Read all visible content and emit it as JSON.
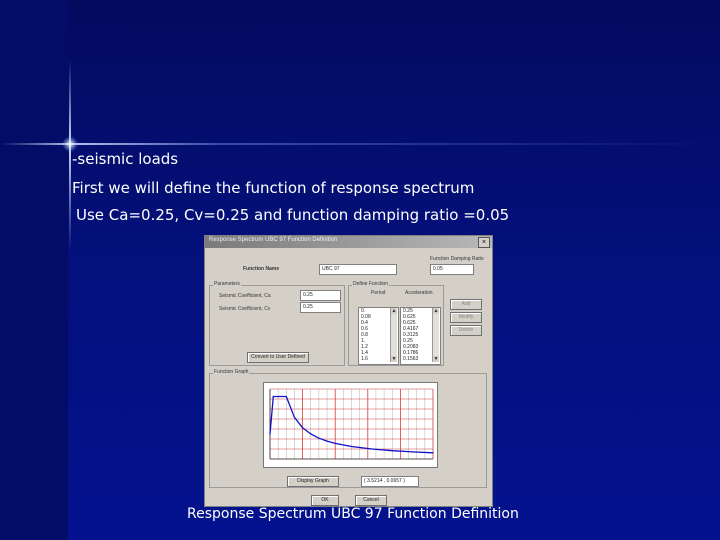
{
  "slide": {
    "heading": "-seismic loads",
    "line1": "First we will define the function of response spectrum",
    "line2": "Use Ca=0.25, Cv=0.25 and function damping ratio =0.05",
    "caption": "Response Spectrum UBC 97 Function Definition"
  },
  "dialog": {
    "title": "Response Spectrum UBC 97 Function Definition",
    "function_name_label": "Function Name",
    "function_name_value": "UBC 97",
    "damping_group": "Function Damping Ratio",
    "damping_value": "0.05",
    "parameters_group": "Parameters",
    "ca_label": "Seismic Coefficient, Ca",
    "ca_value": "0.25",
    "cv_label": "Seismic Coefficient, Cv",
    "cv_value": "0.25",
    "convert_button": "Convert to User Defined",
    "define_group": "Define Function",
    "period_header": "Period",
    "accel_header": "Acceleration",
    "periods": [
      "0.",
      "0.08",
      "0.4",
      "0.6",
      "0.8",
      "1.",
      "1.2",
      "1.4",
      "1.6"
    ],
    "accels": [
      "0.25",
      "0.625",
      "0.625",
      "0.4167",
      "0.3125",
      "0.25",
      "0.2083",
      "0.1786",
      "0.1563"
    ],
    "add_button": "Add",
    "modify_button": "Modify",
    "delete_button": "Delete",
    "graph_group": "Function Graph",
    "display_button": "Display Graph",
    "coord_readout": "( 3.5214 , 0.0657 )",
    "ok_button": "OK",
    "cancel_button": "Cancel"
  },
  "chart_data": {
    "type": "line",
    "x": [
      0,
      0.08,
      0.4,
      0.6,
      0.8,
      1.0,
      1.2,
      1.4,
      1.6,
      2.0,
      2.5,
      3.0,
      3.5,
      4.0
    ],
    "values": [
      0.25,
      0.625,
      0.625,
      0.4167,
      0.3125,
      0.25,
      0.2083,
      0.1786,
      0.1563,
      0.125,
      0.1,
      0.0833,
      0.0714,
      0.0625
    ],
    "xlim": [
      0,
      4
    ],
    "ylim": [
      0,
      0.7
    ],
    "grid": true,
    "colors": {
      "curve": "#1010c8",
      "grid_major": "#d04040",
      "grid_minor": "#b0b0b0"
    }
  }
}
